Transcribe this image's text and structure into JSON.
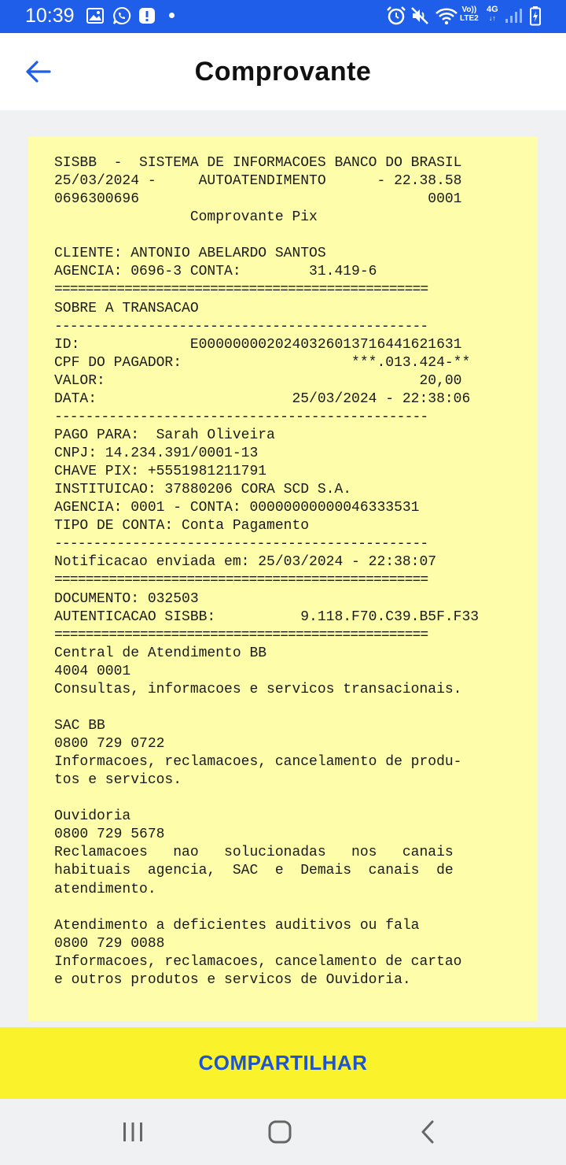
{
  "status_bar": {
    "time": "10:39",
    "volte": "Vo))",
    "lte": "LTE2",
    "network": "4G",
    "icons": [
      "gallery-icon",
      "whatsapp-icon",
      "notification-icon",
      "alarm-icon",
      "mute-icon",
      "wifi-icon",
      "signal-icon",
      "battery-charging-icon"
    ]
  },
  "app_bar": {
    "title": "Comprovante",
    "back_icon": "arrow-left-icon",
    "accent_color": "#1f5ee8"
  },
  "receipt": {
    "background_color": "#fdfdaa",
    "lines": [
      "SISBB  -  SISTEMA DE INFORMACOES BANCO DO BRASIL",
      "25/03/2024 -     AUTOATENDIMENTO      - 22.38.58",
      "0696300696                                  0001",
      "                Comprovante Pix",
      "",
      "CLIENTE: ANTONIO ABELARDO SANTOS",
      "AGENCIA: 0696-3 CONTA:        31.419-6",
      "================================================",
      "SOBRE A TRANSACAO",
      "------------------------------------------------",
      "ID:             E00000000202403260137164416216​31",
      "CPF DO PAGADOR:                    ***.013.424-**",
      "VALOR:                                     20,00",
      "DATA:                       25/03/2024 - 22:38:06",
      "------------------------------------------------",
      "PAGO PARA:  Sarah Oliveira",
      "CNPJ: 14.234.391/0001-13",
      "CHAVE PIX: +5551981211791",
      "INSTITUICAO: 37880206 CORA SCD S.A.",
      "AGENCIA: 0001 - CONTA: 00000000000046333531",
      "TIPO DE CONTA: Conta Pagamento",
      "------------------------------------------------",
      "Notificacao enviada em: 25/03/2024 - 22:38:07",
      "================================================",
      "DOCUMENTO: 032503",
      "AUTENTICACAO SISBB:          9.118.F70.C39.B5F.F33",
      "================================================",
      "Central de Atendimento BB",
      "4004 0001",
      "Consultas, informacoes e servicos transacionais.",
      "",
      "SAC BB",
      "0800 729 0722",
      "Informacoes, reclamacoes, cancelamento de produ-",
      "tos e servicos.",
      "",
      "Ouvidoria",
      "0800 729 5678",
      "Reclamacoes   nao   solucionadas   nos   canais",
      "habituais  agencia,  SAC  e  Demais  canais  de",
      "atendimento.",
      "",
      "Atendimento a deficientes auditivos ou fala",
      "0800 729 0088",
      "Informacoes, reclamacoes, cancelamento de cartao",
      "e outros produtos e servicos de Ouvidoria."
    ]
  },
  "share_button": {
    "label": "COMPARTILHAR",
    "background_color": "#faf22a",
    "text_color": "#1e54d0"
  },
  "nav_bar": {
    "recents_icon": "recents-icon",
    "home_icon": "home-icon",
    "back_icon": "nav-back-icon"
  }
}
